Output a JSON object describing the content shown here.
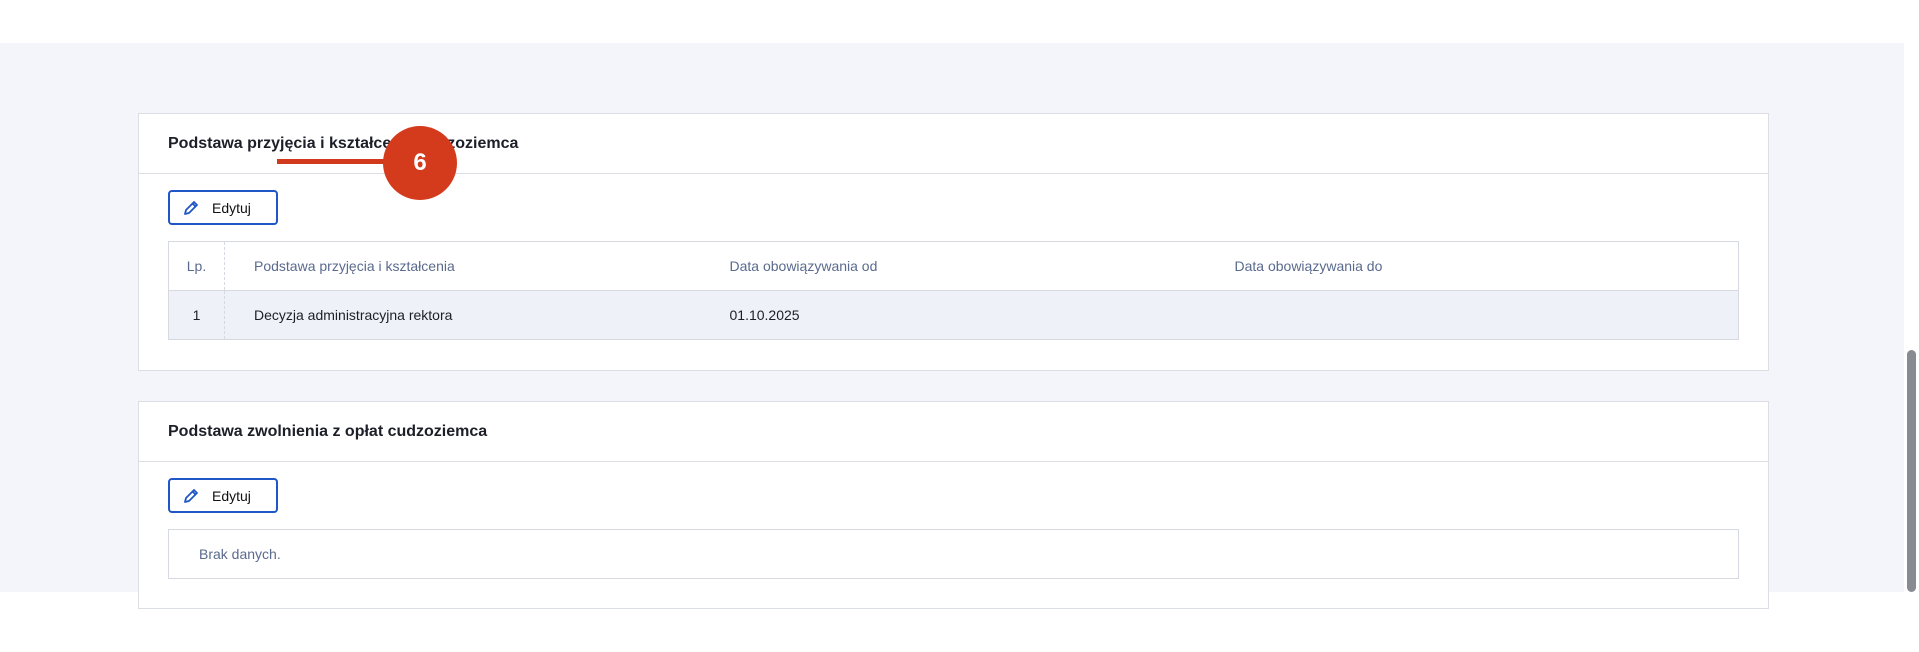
{
  "section1": {
    "title": "Podstawa przyjęcia i kształcenia cudzoziemca",
    "edit_label": "Edytuj",
    "table": {
      "headers": [
        "Lp.",
        "Podstawa przyjęcia i kształcenia",
        "Data obowiązywania od",
        "Data obowiązywania do"
      ],
      "rows": [
        {
          "lp": "1",
          "basis": "Decyzja administracyjna rektora",
          "from": "01.10.2025",
          "to": ""
        }
      ]
    }
  },
  "section2": {
    "title": "Podstawa zwolnienia z opłat cudzoziemca",
    "edit_label": "Edytuj",
    "empty_text": "Brak danych."
  },
  "callout": {
    "number": "6",
    "color": "#d43a1c"
  },
  "colors": {
    "accent": "#1f57c8",
    "background": "#f4f5fa"
  },
  "icons": {
    "edit": "pencil-icon"
  }
}
